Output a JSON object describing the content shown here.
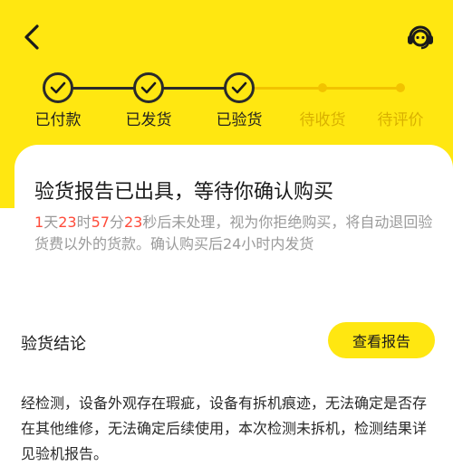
{
  "header": {
    "back_icon": "chevron-left-icon",
    "service_icon": "customer-service-icon"
  },
  "steps": [
    {
      "label": "已付款",
      "done": true
    },
    {
      "label": "已发货",
      "done": true
    },
    {
      "label": "已验货",
      "done": true
    },
    {
      "label": "待收货",
      "done": false
    },
    {
      "label": "待评价",
      "done": false
    }
  ],
  "card": {
    "title": "验货报告已出具，等待你确认购买",
    "countdown": {
      "days": "1",
      "days_unit": "天",
      "hours": "23",
      "hours_unit": "时",
      "minutes": "57",
      "minutes_unit": "分",
      "seconds": "23",
      "seconds_unit": "秒",
      "message": "后未处理，视为你拒绝购买，将自动退回验货费以外的货款。确认购买后24小时内发货"
    },
    "section_label": "验货结论",
    "report_button": "查看报告",
    "conclusion": "经检测，设备外观存在瑕疵，设备有拆机痕迹，无法确定是否存在其他维修，无法确定后续使用，本次检测未拆机，检测结果详见验机报告。"
  },
  "colors": {
    "brand_yellow": "#FFE711",
    "pending_yellow": "#F2C300",
    "countdown_red": "#FF4B3A"
  }
}
